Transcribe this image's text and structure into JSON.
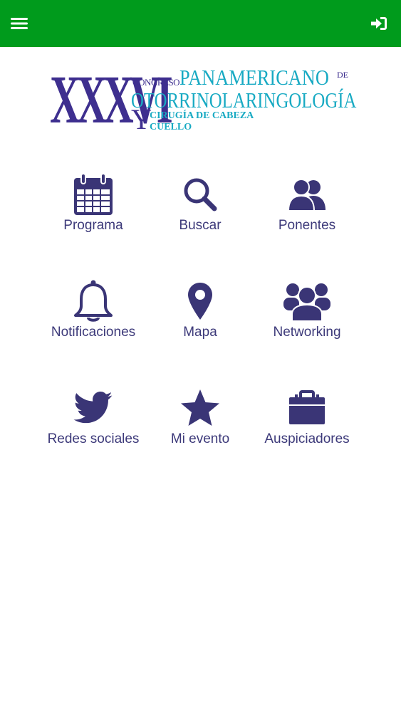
{
  "header": {
    "menu_icon": "hamburger-menu-icon",
    "login_icon": "sign-in-icon",
    "bar_color": "#009b1c"
  },
  "logo": {
    "roman_numeral": "XXXVI",
    "congreso": "CONGRESO",
    "panamericano": "PANAMERICANO",
    "de": "DE",
    "otorrino": "OTORRINOLARINGOLOGÍA",
    "y": "Y",
    "cirugia": "CIRUGÍA DE CABEZA",
    "cuello": "CUELLO"
  },
  "menu": {
    "items": [
      {
        "label": "Programa",
        "icon": "calendar-icon"
      },
      {
        "label": "Buscar",
        "icon": "search-icon"
      },
      {
        "label": "Ponentes",
        "icon": "users-icon"
      },
      {
        "label": "Notificaciones",
        "icon": "bell-icon"
      },
      {
        "label": "Mapa",
        "icon": "map-marker-icon"
      },
      {
        "label": "Networking",
        "icon": "group-icon"
      },
      {
        "label": "Redes sociales",
        "icon": "twitter-icon"
      },
      {
        "label": "Mi evento",
        "icon": "star-icon"
      },
      {
        "label": "Auspiciadores",
        "icon": "briefcase-icon"
      }
    ]
  },
  "colors": {
    "icon": "#3a3576",
    "label": "#3d3a7a",
    "logo_purple": "#3e2f8f",
    "logo_cyan": "#18aac3"
  }
}
